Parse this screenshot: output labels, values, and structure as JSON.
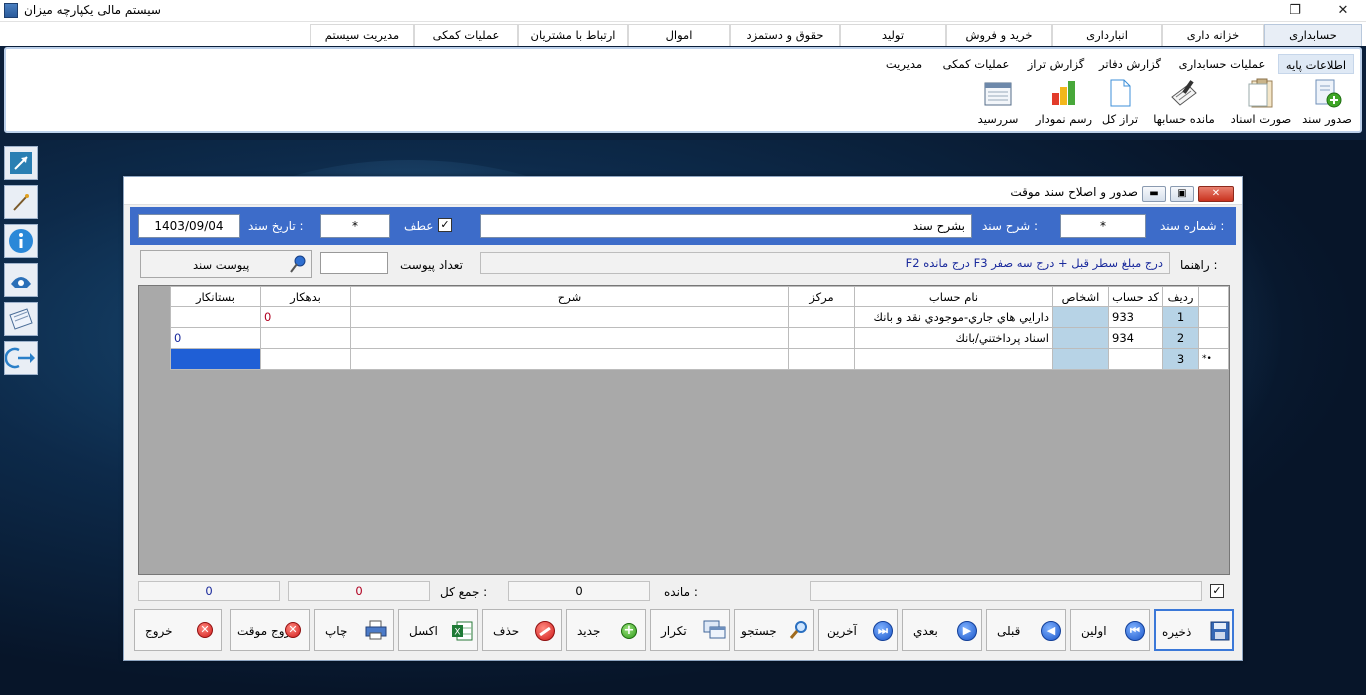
{
  "titlebar": {
    "title": "سیستم مالی یکپارچه میزان",
    "maximize_glyph": "❐",
    "close_glyph": "✕"
  },
  "menu_tabs": [
    "حسابداری",
    "خزانه داری",
    "انبارداری",
    "خرید و فروش",
    "تولید",
    "حقوق و دستمزد",
    "اموال",
    "ارتباط با مشتریان",
    "عملیات کمکی",
    "مدیریت سیستم"
  ],
  "ribbon": {
    "subtabs": [
      "اطلاعات پایه",
      "عملیات حسابداری",
      "گزارش دفاتر",
      "گزارش تراز",
      "عملیات کمکی",
      "مدیریت"
    ],
    "buttons": [
      "صدور سند",
      "صورت اسناد",
      "مانده حسابها",
      "تراز کل",
      "رسم نمودار",
      "سررسید"
    ]
  },
  "window": {
    "title": "صدور و اصلاح سند موقت",
    "doc_number_label": "شماره سند :",
    "doc_number_value": "*",
    "description_label": "شرح سند :",
    "description_value": "بشرح سند",
    "atf_label": "عطف",
    "atf_checked": "✓",
    "atf_value": "*",
    "date_label": "تاریخ سند :",
    "date_value": "1403/09/04",
    "guide_label": "راهنما :",
    "guide_text": "F2 درج مانده F3 درج مبلغ سطر قبل + درج سه صفر",
    "attach_count_label": "تعداد پیوست",
    "attach_count_value": "",
    "attach_button": "پیوست سند"
  },
  "grid": {
    "columns": [
      "ردیف",
      "کد حساب",
      "اشخاص",
      "نام حساب",
      "مرکز",
      "شرح",
      "بدهکار",
      "بستانکار"
    ],
    "rows": [
      {
        "marker": "",
        "row": "1",
        "code": "933",
        "person": "",
        "name": "دارايي هاي جاري-موجودي نقد و بانك",
        "center": "",
        "desc": "",
        "debit": "0",
        "credit": ""
      },
      {
        "marker": "",
        "row": "2",
        "code": "934",
        "person": "",
        "name": "اسناد پرداختني/بانك",
        "center": "",
        "desc": "",
        "debit": "",
        "credit": "0"
      },
      {
        "marker": "*•",
        "row": "3",
        "code": "",
        "person": "",
        "name": "",
        "center": "",
        "desc": "",
        "debit": "",
        "credit": ""
      }
    ]
  },
  "totals": {
    "check_glyph": "✓",
    "remain_label": "مانده :",
    "remain_value": "0",
    "sum_label": "جمع کل :",
    "sum_debit": "0",
    "sum_credit": "0"
  },
  "buttons": {
    "save": "ذخیره",
    "first": "اولین",
    "prev": "قبلی",
    "next": "بعدي",
    "last": "آخرین",
    "search": "جستجو",
    "repeat": "تکرار",
    "new": "جدید",
    "delete": "حذف",
    "excel": "اکسل",
    "print": "چاپ",
    "temp_exit": "خروج موقت",
    "exit": "خروج"
  }
}
